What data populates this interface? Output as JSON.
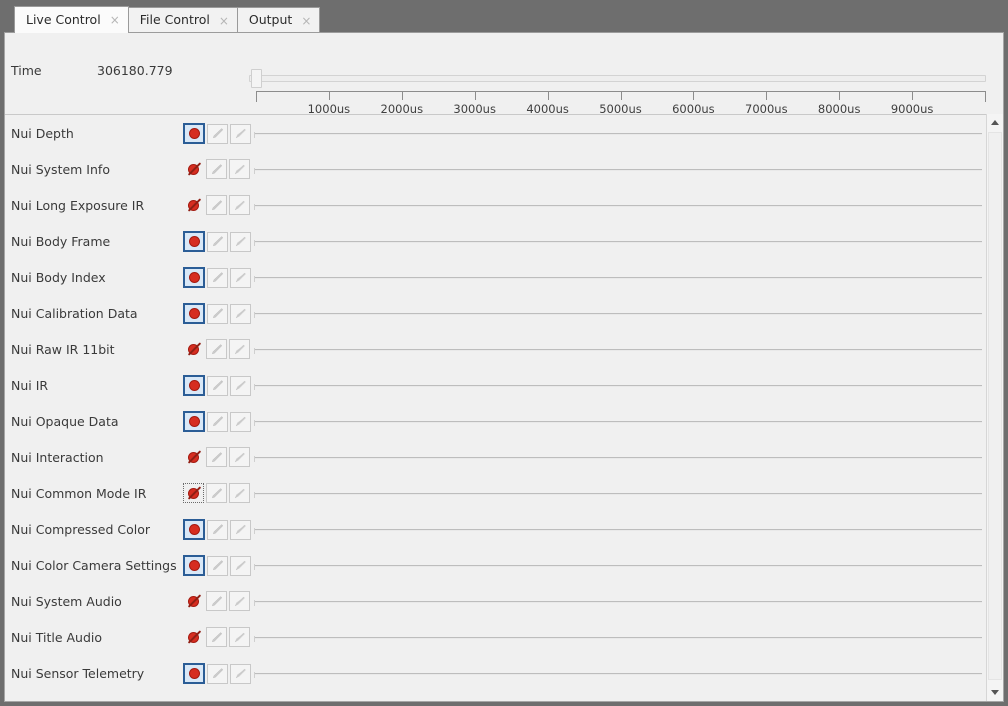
{
  "window": {
    "title": "Live Control"
  },
  "tabs": [
    {
      "label": "Live Control",
      "close": "×",
      "active": true
    },
    {
      "label": "File Control",
      "close": "×",
      "active": false
    },
    {
      "label": "Output",
      "close": "×",
      "active": false
    }
  ],
  "time": {
    "label": "Time",
    "value": "306180.779"
  },
  "slider": {
    "name": "timeline-position-slider",
    "position_percent": 0
  },
  "ruler": {
    "unit": "us",
    "ticks": [
      {
        "label": "1000us",
        "value": 1000
      },
      {
        "label": "2000us",
        "value": 2000
      },
      {
        "label": "3000us",
        "value": 3000
      },
      {
        "label": "4000us",
        "value": 4000
      },
      {
        "label": "5000us",
        "value": 5000
      },
      {
        "label": "6000us",
        "value": 6000
      },
      {
        "label": "7000us",
        "value": 7000
      },
      {
        "label": "8000us",
        "value": 8000
      },
      {
        "label": "9000us",
        "value": 9000
      }
    ],
    "range": [
      0,
      10000
    ]
  },
  "colors": {
    "titlebar": "#6e6e6e",
    "panel": "#f0f0f0",
    "record_red": "#d62d20",
    "record_active_border": "#2b5d96",
    "record_active_fill": "#d9e8f7",
    "track_line": "#bdbdbd",
    "text": "#3a3a3a"
  },
  "buttons": {
    "record_label": "record",
    "edit_label": "edit",
    "clear_label": "clear"
  },
  "tracks": [
    {
      "label": "Nui Depth",
      "recording": true,
      "focused": false
    },
    {
      "label": "Nui System Info",
      "recording": false,
      "focused": false
    },
    {
      "label": "Nui Long Exposure IR",
      "recording": false,
      "focused": false
    },
    {
      "label": "Nui Body Frame",
      "recording": true,
      "focused": false
    },
    {
      "label": "Nui Body Index",
      "recording": true,
      "focused": false
    },
    {
      "label": "Nui Calibration Data",
      "recording": true,
      "focused": false
    },
    {
      "label": "Nui Raw IR 11bit",
      "recording": false,
      "focused": false
    },
    {
      "label": "Nui IR",
      "recording": true,
      "focused": false
    },
    {
      "label": "Nui Opaque Data",
      "recording": true,
      "focused": false
    },
    {
      "label": "Nui Interaction",
      "recording": false,
      "focused": false
    },
    {
      "label": "Nui Common Mode IR",
      "recording": false,
      "focused": true
    },
    {
      "label": "Nui Compressed Color",
      "recording": true,
      "focused": false
    },
    {
      "label": "Nui Color Camera Settings",
      "recording": true,
      "focused": false
    },
    {
      "label": "Nui System Audio",
      "recording": false,
      "focused": false
    },
    {
      "label": "Nui Title Audio",
      "recording": false,
      "focused": false
    },
    {
      "label": "Nui Sensor Telemetry",
      "recording": true,
      "focused": false
    }
  ],
  "scrollbar": {
    "up_arrow": "▲",
    "down_arrow": "▼"
  }
}
